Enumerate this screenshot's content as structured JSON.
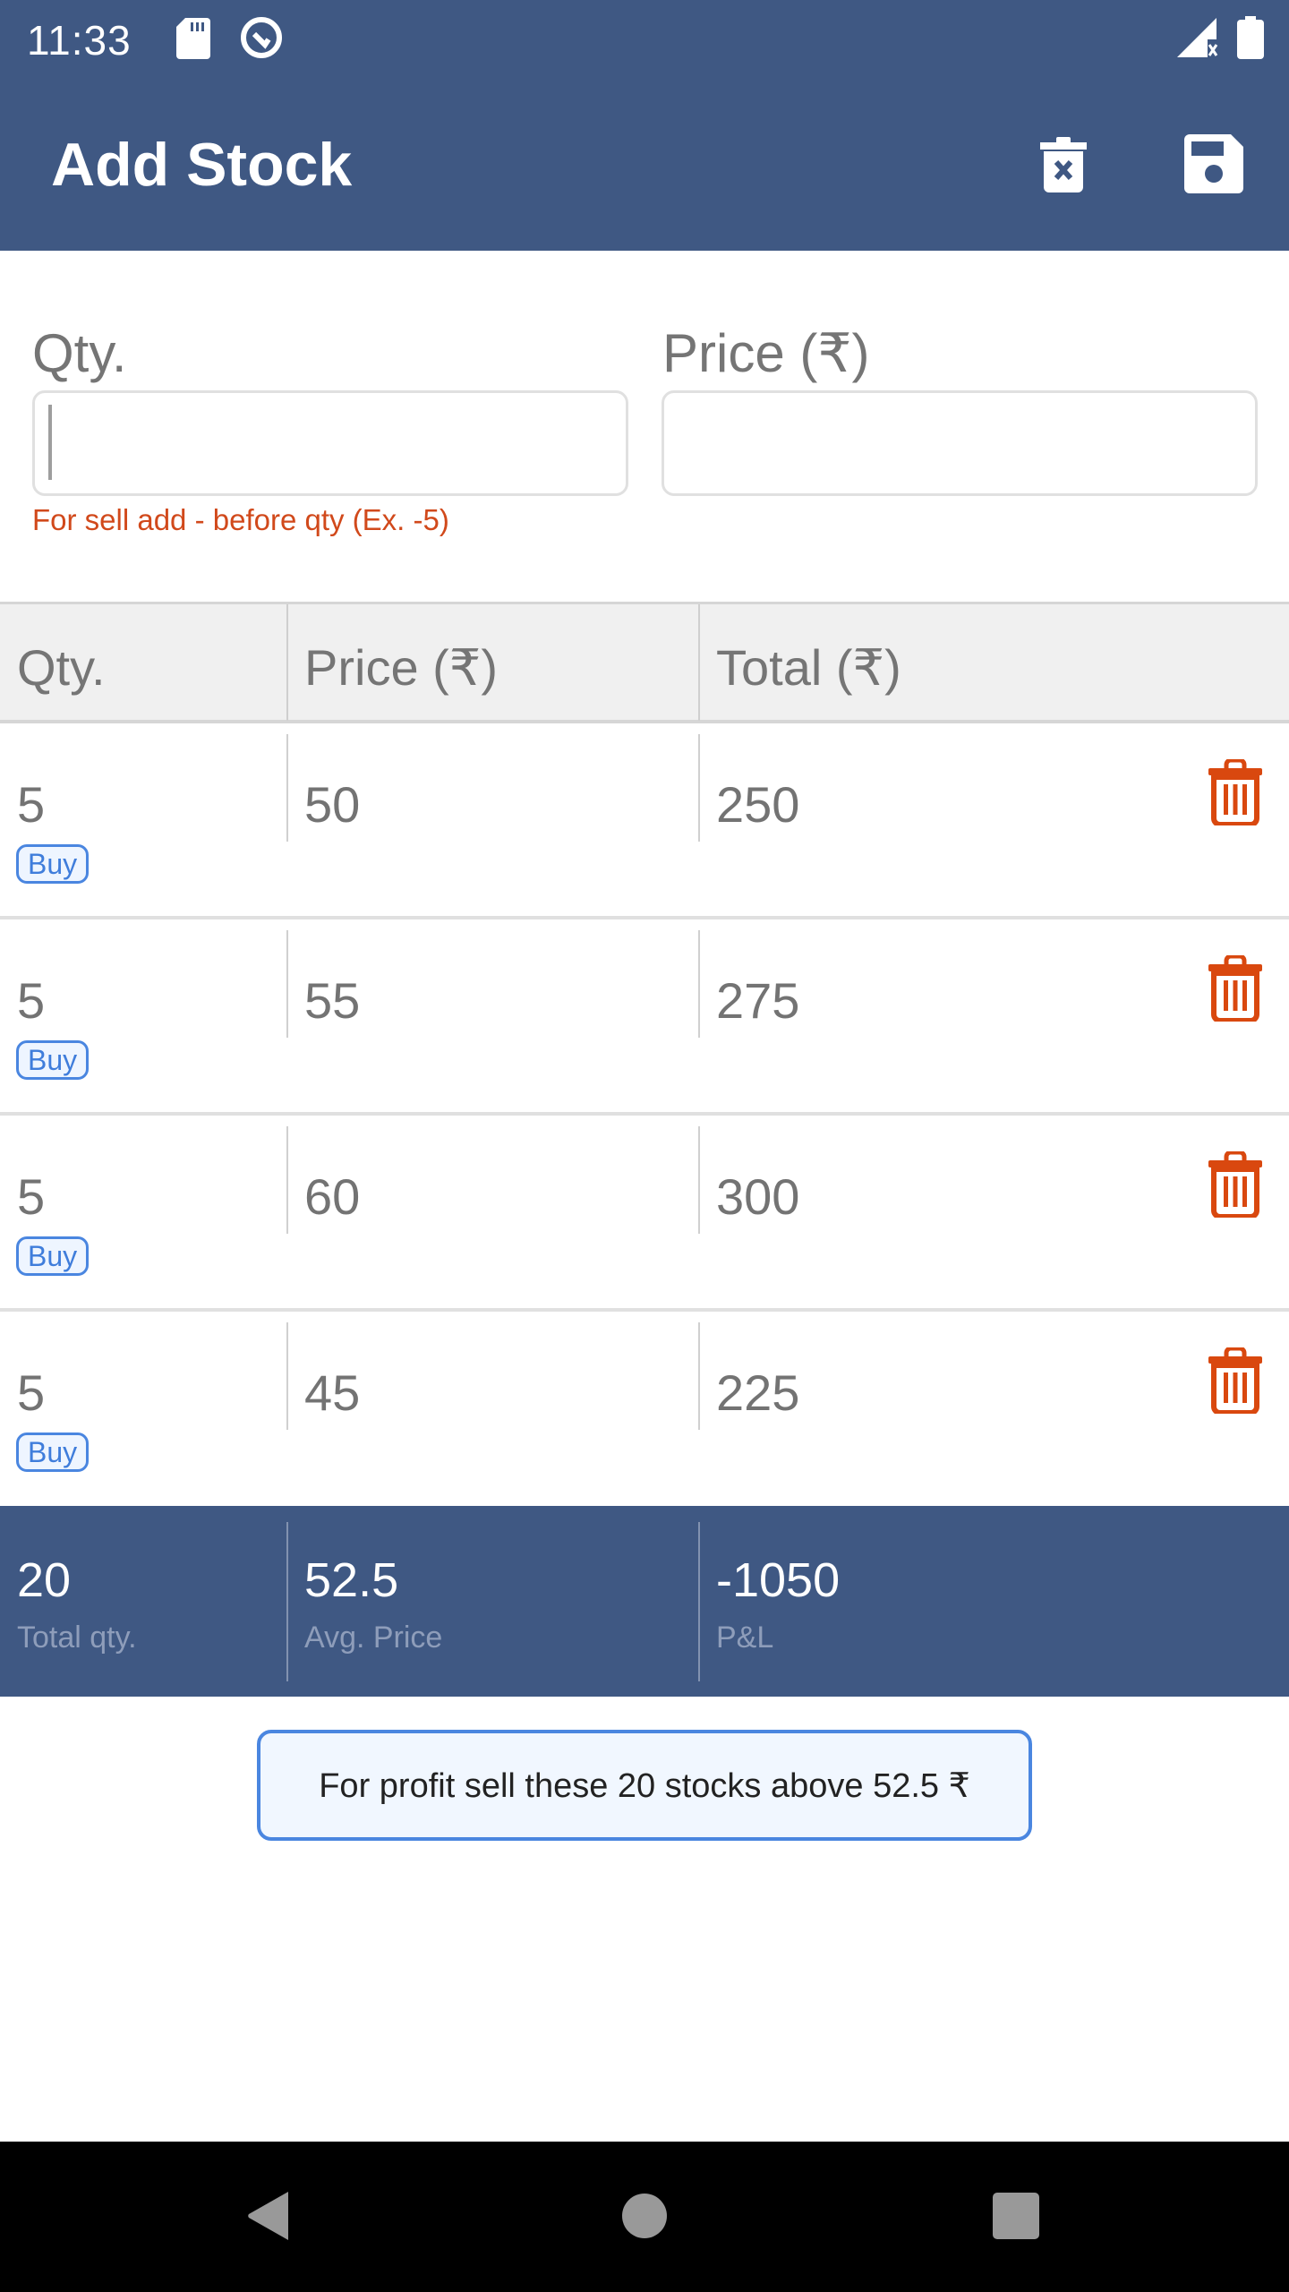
{
  "status_bar": {
    "time": "11:33",
    "left_icons": [
      "sd-card-icon",
      "data-saver-icon"
    ],
    "right_icons": [
      "signal-no-data-icon",
      "battery-icon"
    ]
  },
  "app_bar": {
    "title": "Add Stock",
    "actions": [
      {
        "name": "clear-all-button",
        "icon": "trash-x-icon"
      },
      {
        "name": "save-button",
        "icon": "floppy-disk-icon"
      }
    ],
    "background": "#3F5883"
  },
  "form": {
    "qty_label": "Qty.",
    "qty_value": "",
    "price_label": "Price (₹)",
    "price_value": "",
    "helper_text": "For sell add - before qty (Ex. -5)",
    "helper_color": "#D1491B"
  },
  "table": {
    "headers": [
      "Qty.",
      "Price (₹)",
      "Total (₹)"
    ],
    "rows": [
      {
        "qty": "5",
        "type": "Buy",
        "price": "50",
        "total": "250"
      },
      {
        "qty": "5",
        "type": "Buy",
        "price": "55",
        "total": "275"
      },
      {
        "qty": "5",
        "type": "Buy",
        "price": "60",
        "total": "300"
      },
      {
        "qty": "5",
        "type": "Buy",
        "price": "45",
        "total": "225"
      }
    ],
    "delete_icon_color": "#D9480F",
    "badge_color": "#4A86E0"
  },
  "summary": {
    "total_qty": "20",
    "total_qty_label": "Total qty.",
    "avg_price": "52.5",
    "avg_price_label": "Avg. Price",
    "pnl": "-1050",
    "pnl_label": "P&L"
  },
  "info_message": "For profit sell these 20 stocks above 52.5 ₹",
  "nav_bar": {
    "buttons": [
      "back",
      "home",
      "recents"
    ]
  }
}
